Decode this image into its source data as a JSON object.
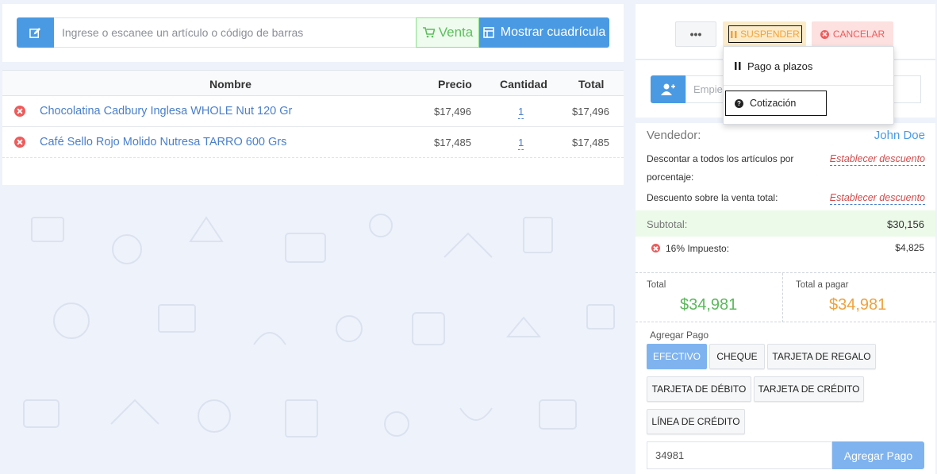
{
  "register": {
    "search_placeholder": "Ingrese o escanee un artículo o código de barras",
    "mode_label": "Venta",
    "grid_label": "Mostrar cuadrícula"
  },
  "cart": {
    "headers": {
      "name": "Nombre",
      "price": "Precio",
      "qty": "Cantidad",
      "total": "Total"
    },
    "items": [
      {
        "name": "Chocolatina Cadbury Inglesa WHOLE Nut 120 Gr",
        "price": "$17,496",
        "qty": "1",
        "total": "$17,496"
      },
      {
        "name": "Café Sello Rojo Molido Nutresa TARRO 600 Grs",
        "price": "$17,485",
        "qty": "1",
        "total": "$17,485"
      }
    ]
  },
  "actions": {
    "more_label": "•••",
    "suspend_label": "SUSPENDER",
    "cancel_label": "CANCELAR"
  },
  "dropdown": {
    "item1": "Pago a plazos",
    "item2": "Cotización"
  },
  "customer": {
    "placeholder": "Empiece a escribir el nombre del cliente..."
  },
  "summary": {
    "seller_label": "Vendedor:",
    "seller_name": "John Doe",
    "discount_all_label_1": "Descontar a todos los artículos por",
    "discount_all_label_2": "porcentaje:",
    "discount_all_link": "Establecer descuento",
    "discount_total_label": "Descuento sobre la venta total:",
    "discount_total_link": "Establecer descuento",
    "subtotal_label": "Subtotal:",
    "subtotal_value": "$30,156",
    "tax_label": "16% Impuesto:",
    "tax_value": "$4,825",
    "total_label": "Total",
    "total_value": "$34,981",
    "due_label": "Total a pagar",
    "due_value": "$34,981",
    "total_color": "#5cb85c",
    "due_color": "#f0a23d"
  },
  "payment": {
    "title": "Agregar Pago",
    "methods": [
      "EFECTIVO",
      "CHEQUE",
      "TARJETA DE REGALO",
      "TARJETA DE DÉBITO",
      "TARJETA DE CRÉDITO",
      "LÍNEA DE CRÉDITO"
    ],
    "amount_value": "34981",
    "add_label": "Agregar Pago"
  },
  "colors": {
    "accent": "#4a9ae3",
    "danger": "#ee5b5b",
    "success": "#5cb85c",
    "warning": "#f0a23d"
  }
}
